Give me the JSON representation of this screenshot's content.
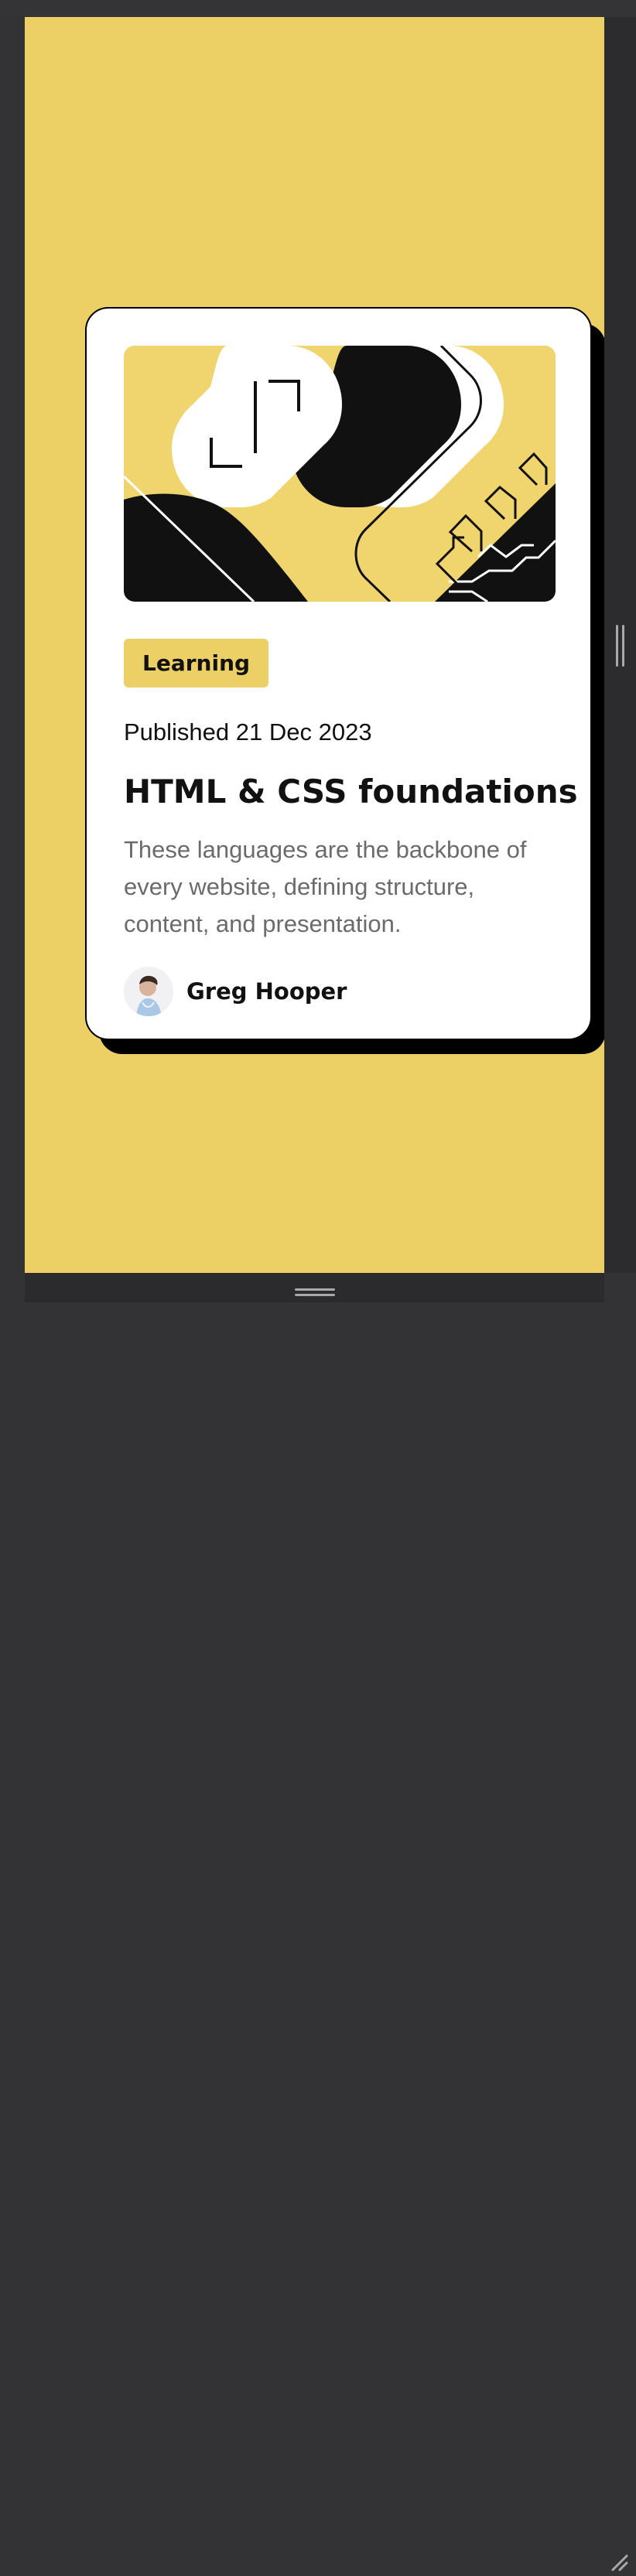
{
  "card": {
    "category": "Learning",
    "published": "Published 21 Dec 2023",
    "title": "HTML & CSS foundations",
    "description": "These languages are the backbone of every website, defining structure, content, and presentation.",
    "author": "Greg Hooper"
  },
  "colors": {
    "background": "#ecd066",
    "card": "#ffffff",
    "text": "#111111",
    "muted_text": "#6b6b6b",
    "frame": "#333336"
  },
  "icons": {
    "hero": "html-css-illustration",
    "avatar": "author-avatar-photo",
    "resize": "resize-grip-icon"
  }
}
